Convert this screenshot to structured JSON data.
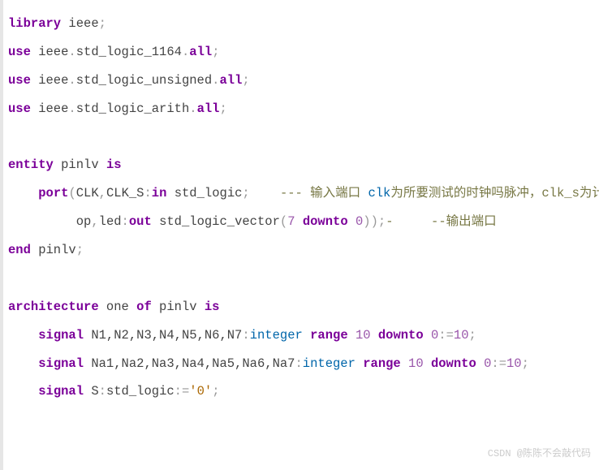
{
  "code": {
    "l1": {
      "kw1": "library",
      "id": " ieee",
      "sc": ";"
    },
    "l2": {
      "kw1": "use",
      "id1": " ieee",
      "op1": ".",
      "id2": "std_logic_1164",
      "op2": ".",
      "kw2": "all",
      "sc": ";"
    },
    "l3": {
      "kw1": "use",
      "id1": " ieee",
      "op1": ".",
      "id2": "std_logic_unsigned",
      "op2": ".",
      "kw2": "all",
      "sc": ";"
    },
    "l4": {
      "kw1": "use",
      "id1": " ieee",
      "op1": ".",
      "id2": "std_logic_arith",
      "op2": ".",
      "kw2": "all",
      "sc": ";"
    },
    "l6": {
      "kw1": "entity",
      "id": " pinlv ",
      "kw2": "is"
    },
    "l7": {
      "indent": "    ",
      "kw1": "port",
      "op1": "(",
      "id1": "CLK",
      "cm": ",",
      "id2": "CLK_S",
      "op2": ":",
      "kw2": "in",
      "id3": " std_logic",
      "sc": ";    ",
      "d1": "---",
      "c1": " 输入端口 ",
      "blue": "clk",
      "c2": "为所要测试的时钟吗脉冲，",
      "id4": "clk_s",
      "c3": "为计时时钟"
    },
    "l8": {
      "indent": "         ",
      "id1": "op",
      "cm": ",",
      "id2": "led",
      "op1": ":",
      "kw1": "out",
      "id3": " std_logic_vector",
      "op2": "(",
      "n1": "7",
      "kw2": " downto ",
      "n2": "0",
      "op3": "))",
      "sc": ";",
      "d1": "-",
      "sp": "     ",
      "d2": "--",
      "c1": "输出端口"
    },
    "l9": {
      "kw1": "end",
      "id": " pinlv",
      "sc": ";"
    },
    "l11": {
      "kw1": "architecture",
      "id1": " one ",
      "kw2": "of",
      "id2": " pinlv ",
      "kw3": "is"
    },
    "l12": {
      "indent": "    ",
      "kw1": "signal",
      "id": " N1,N2,N3,N4,N5,N6,N7",
      "op1": ":",
      "typ": "integer",
      "kw2": " range ",
      "n1": "10",
      "kw3": " downto ",
      "n2": "0",
      "op2": ":=",
      "n3": "10",
      "sc": ";"
    },
    "l13": {
      "indent": "    ",
      "kw1": "signal",
      "id": " Na1,Na2,Na3,Na4,Na5,Na6,Na7",
      "op1": ":",
      "typ": "integer",
      "kw2": " range ",
      "n1": "10",
      "kw3": " downto ",
      "n2": "0",
      "op2": ":=",
      "n3": "10",
      "sc": ";"
    },
    "l14": {
      "indent": "    ",
      "kw1": "signal",
      "id": " S",
      "op1": ":",
      "typ": "std_logic",
      "op2": ":=",
      "lit": "'0'",
      "sc": ";"
    }
  },
  "watermark": "CSDN @陈陈不会敲代码"
}
